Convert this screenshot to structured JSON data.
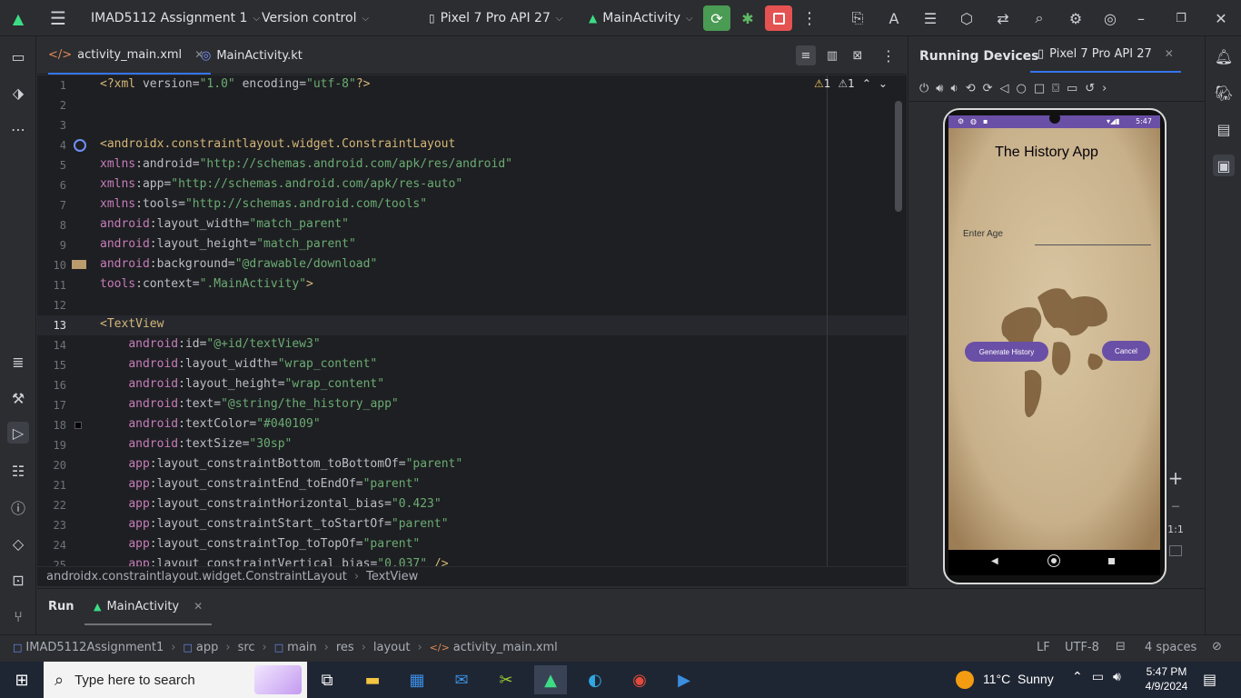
{
  "titlebar": {
    "project": "IMAD5112 Assignment 1",
    "vcs": "Version control",
    "device": "Pixel 7 Pro API 27",
    "run_config": "MainActivity"
  },
  "editor_tabs": [
    {
      "label": "activity_main.xml",
      "active": true
    },
    {
      "label": "MainActivity.kt",
      "active": false
    }
  ],
  "inspection": {
    "warnings": "1",
    "weak_warnings": "1"
  },
  "code_lines": [
    {
      "n": "1",
      "text": "<?xml version=\"1.0\" encoding=\"utf-8\"?>"
    },
    {
      "n": "2",
      "text": ""
    },
    {
      "n": "3",
      "text": ""
    },
    {
      "n": "4",
      "text": "<androidx.constraintlayout.widget.ConstraintLayout"
    },
    {
      "n": "5",
      "text": "xmlns:android=\"http://schemas.android.com/apk/res/android\""
    },
    {
      "n": "6",
      "text": "xmlns:app=\"http://schemas.android.com/apk/res-auto\""
    },
    {
      "n": "7",
      "text": "xmlns:tools=\"http://schemas.android.com/tools\""
    },
    {
      "n": "8",
      "text": "android:layout_width=\"match_parent\""
    },
    {
      "n": "9",
      "text": "android:layout_height=\"match_parent\""
    },
    {
      "n": "10",
      "text": "android:background=\"@drawable/download\""
    },
    {
      "n": "11",
      "text": "tools:context=\".MainActivity\">"
    },
    {
      "n": "12",
      "text": ""
    },
    {
      "n": "13",
      "text": "<TextView"
    },
    {
      "n": "14",
      "text": "    android:id=\"@+id/textView3\""
    },
    {
      "n": "15",
      "text": "    android:layout_width=\"wrap_content\""
    },
    {
      "n": "16",
      "text": "    android:layout_height=\"wrap_content\""
    },
    {
      "n": "17",
      "text": "    android:text=\"@string/the_history_app\""
    },
    {
      "n": "18",
      "text": "    android:textColor=\"#040109\""
    },
    {
      "n": "19",
      "text": "    android:textSize=\"30sp\""
    },
    {
      "n": "20",
      "text": "    app:layout_constraintBottom_toBottomOf=\"parent\""
    },
    {
      "n": "21",
      "text": "    app:layout_constraintEnd_toEndOf=\"parent\""
    },
    {
      "n": "22",
      "text": "    app:layout_constraintHorizontal_bias=\"0.423\""
    },
    {
      "n": "23",
      "text": "    app:layout_constraintStart_toStartOf=\"parent\""
    },
    {
      "n": "24",
      "text": "    app:layout_constraintTop_toTopOf=\"parent\""
    },
    {
      "n": "25",
      "text": "    app:layout_constraintVertical_bias=\"0.037\" />"
    }
  ],
  "breadcrumb": [
    "androidx.constraintlayout.widget.ConstraintLayout",
    "TextView"
  ],
  "devices": {
    "title": "Running Devices",
    "tab": "Pixel 7 Pro API 27",
    "zoom_label": "1:1"
  },
  "phone": {
    "status_time": "5:47",
    "app_title": "The History App",
    "age_label": "Enter Age",
    "generate_button": "Generate History",
    "cancel_button": "Cancel"
  },
  "run": {
    "tab_label": "Run",
    "config": "MainActivity"
  },
  "statusbar": {
    "path": [
      "IMAD5112Assignment1",
      "app",
      "src",
      "main",
      "res",
      "layout",
      "activity_main.xml"
    ],
    "line_sep": "LF",
    "encoding": "UTF-8",
    "indent": "4 spaces"
  },
  "taskbar": {
    "search_placeholder": "Type here to search",
    "weather": "11°C  Sunny",
    "time": "5:47 PM",
    "date": "4/9/2024"
  },
  "colors": {
    "accent": "#6a4fa6",
    "run_green": "#4a9b54",
    "stop_red": "#e55252"
  }
}
